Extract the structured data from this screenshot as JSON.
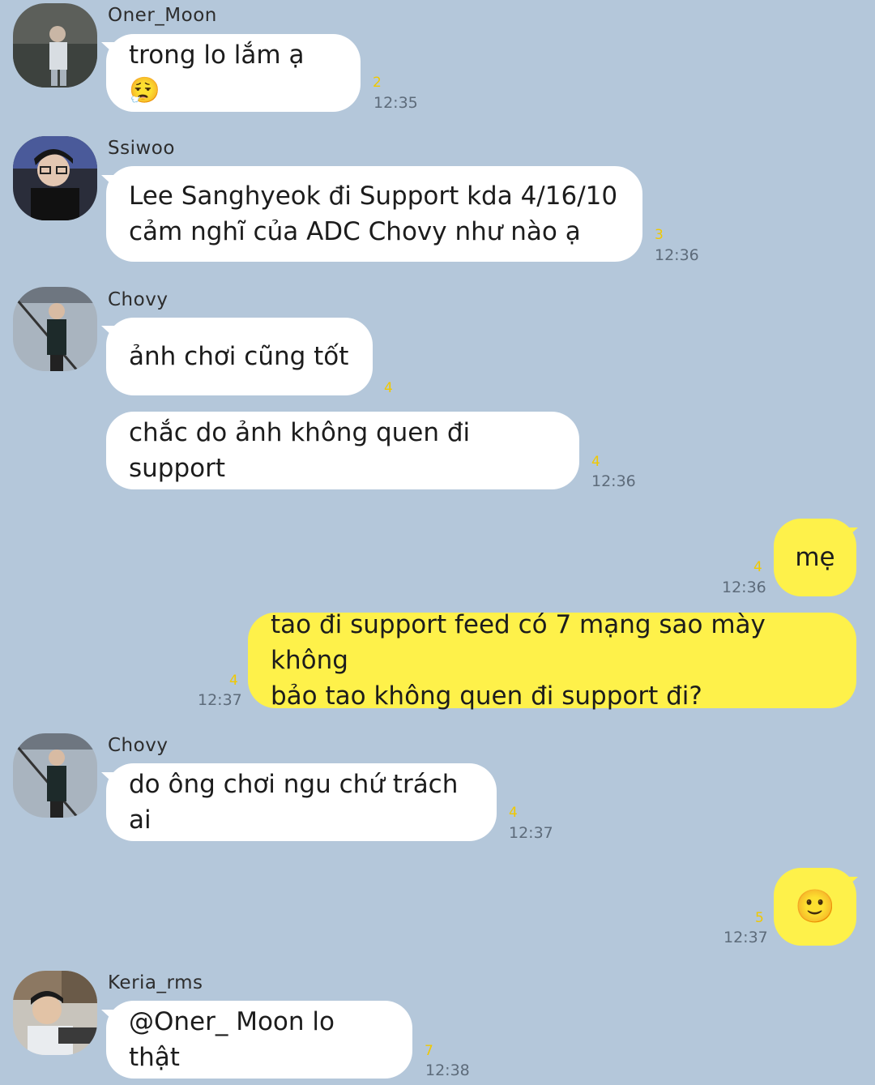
{
  "messages": [
    {
      "sender": "Oner_Moon",
      "text": "trong lo lắm ạ 😮‍💨",
      "count": "2",
      "time": "12:35"
    },
    {
      "sender": "Ssiwoo",
      "text": "Lee Sanghyeok đi Support kda 4/16/10\ncảm nghĩ của ADC Chovy như nào ạ",
      "count": "3",
      "time": "12:36"
    },
    {
      "sender": "Chovy",
      "text": "ảnh chơi cũng tốt",
      "count": "4",
      "time": ""
    },
    {
      "sender": "",
      "text": "chắc do ảnh không quen đi support",
      "count": "4",
      "time": "12:36"
    },
    {
      "sender": "me",
      "text": "mẹ",
      "count": "4",
      "time": "12:36"
    },
    {
      "sender": "me",
      "text": "tao đi support feed có 7 mạng sao mày không\nbảo tao không quen đi support đi?",
      "count": "4",
      "time": "12:37"
    },
    {
      "sender": "Chovy",
      "text": "do ông chơi ngu chứ trách ai",
      "count": "4",
      "time": "12:37"
    },
    {
      "sender": "me",
      "text": "🙂",
      "count": "5",
      "time": "12:37"
    },
    {
      "sender": "Keria_rms",
      "text": "@Oner_ Moon lo thật",
      "count": "7",
      "time": "12:38"
    }
  ],
  "colors": {
    "background": "#b4c7da",
    "incoming": "#ffffff",
    "outgoing": "#fef14a",
    "unread": "#f0c800"
  }
}
